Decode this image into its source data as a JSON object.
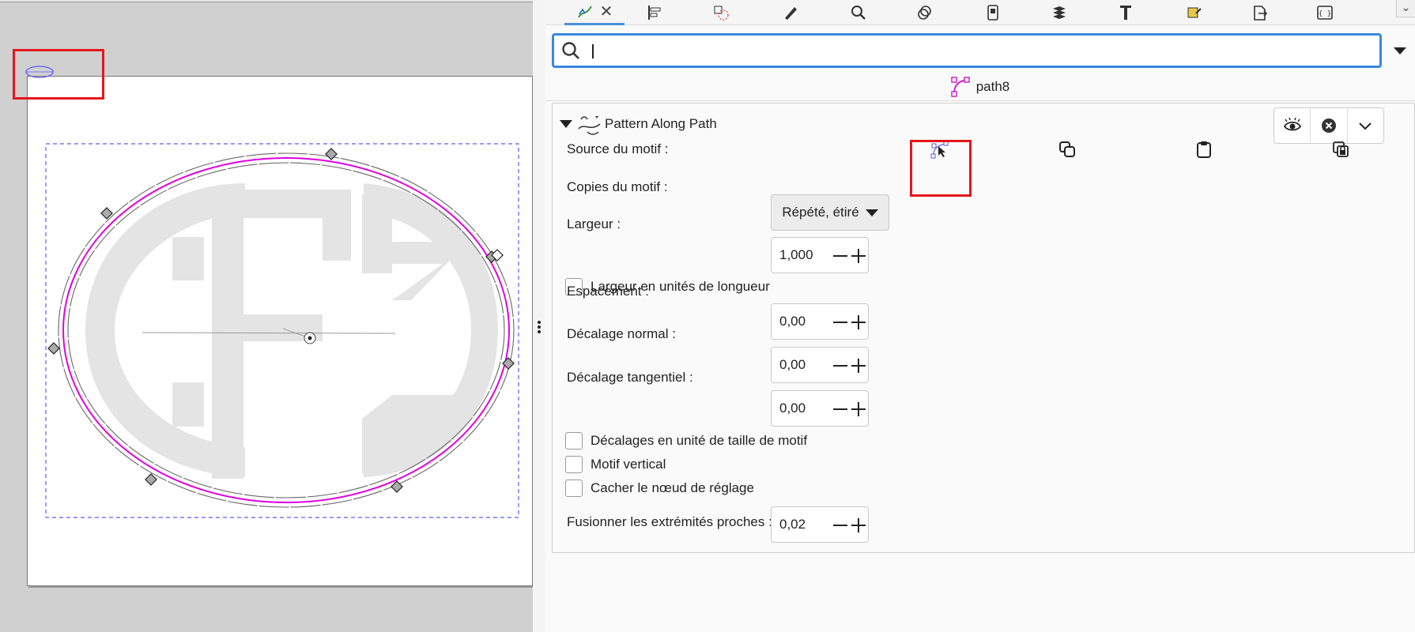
{
  "toolbar": {
    "tabs": [
      {
        "icon": "path-effects-icon",
        "active": true
      },
      {
        "icon": "align-icon"
      },
      {
        "icon": "transform-icon"
      },
      {
        "icon": "fill-stroke-icon"
      },
      {
        "icon": "find-icon"
      },
      {
        "icon": "symbols-icon"
      },
      {
        "icon": "document-properties-icon"
      },
      {
        "icon": "layers-icon"
      },
      {
        "icon": "text-font-icon"
      },
      {
        "icon": "selectors-icon"
      },
      {
        "icon": "export-icon"
      },
      {
        "icon": "xml-editor-icon"
      }
    ],
    "close_glyph": "✕",
    "overflow_glyph": "⌄"
  },
  "search": {
    "value": "",
    "placeholder": ""
  },
  "object": {
    "name": "path8",
    "icon": "node-path-icon"
  },
  "effect": {
    "title": "Pattern Along Path",
    "icon": "pattern-along-path-icon",
    "actions": [
      "visibility-eye-icon",
      "remove-effect-icon",
      "menu-chevron-icon"
    ],
    "params": {
      "source_label": "Source du motif :",
      "source_buttons": [
        "edit-on-canvas-icon",
        "copy-icon",
        "paste-icon",
        "link-to-clipboard-icon"
      ],
      "copies_label": "Copies du motif :",
      "copies_value": "Répété, étiré",
      "width_label": "Largeur :",
      "width_value": "1,000",
      "width_units_label": "Largeur en unités de longueur",
      "spacing_label": "Espacement :",
      "spacing_value": "0,00",
      "normal_offset_label": "Décalage normal :",
      "normal_offset_value": "0,00",
      "tangential_offset_label": "Décalage tangentiel :",
      "tangential_offset_value": "0,00",
      "offsets_in_pattern_units_label": "Décalages en unité de taille de motif",
      "vertical_pattern_label": "Motif vertical",
      "hide_knot_label": "Cacher le nœud de réglage",
      "fuse_label": "Fusionner les extrémités proches :",
      "fuse_value": "0,02"
    }
  },
  "canvas": {
    "monogram": "CFZ",
    "path_color": "#e000e0",
    "selection_color": "#5a5aff",
    "annotation_color": "#e5161c"
  }
}
